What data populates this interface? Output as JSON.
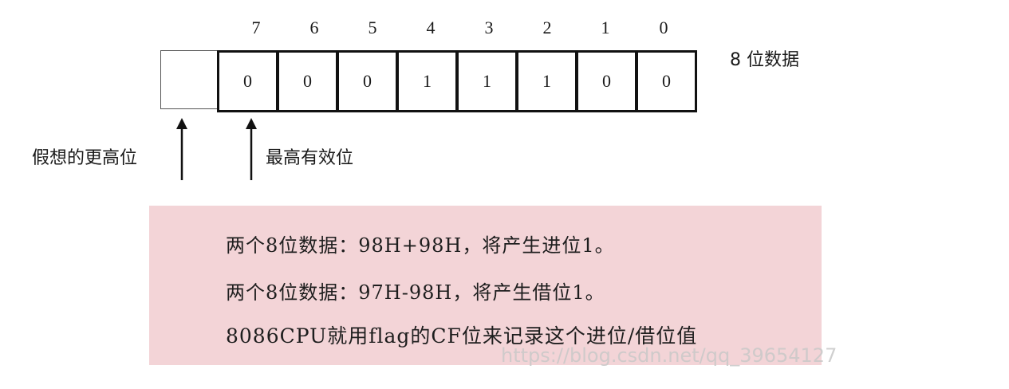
{
  "diagram": {
    "bit_indices": [
      "7",
      "6",
      "5",
      "4",
      "3",
      "2",
      "1",
      "0"
    ],
    "bit_values": [
      "0",
      "0",
      "0",
      "1",
      "1",
      "1",
      "0",
      "0"
    ],
    "register_caption": "8 位数据",
    "imaginary_bit_label": "假想的更高位",
    "msb_label": "最高有效位"
  },
  "note": {
    "lines": [
      "两个8位数据：98H+98H，将产生进位1。",
      "两个8位数据：97H-98H，将产生借位1。",
      "8086CPU就用flag的CF位来记录这个进位/借位值"
    ],
    "background": "#f3d4d7"
  },
  "watermark": "https://blog.csdn.net/qq_39654127"
}
